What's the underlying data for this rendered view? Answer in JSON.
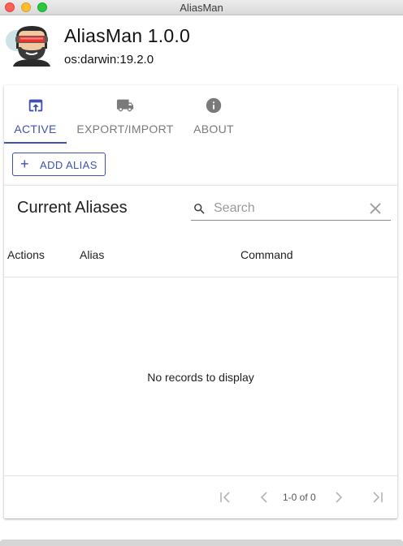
{
  "window": {
    "title": "AliasMan"
  },
  "header": {
    "title": "AliasMan 1.0.0",
    "subtitle": "os:darwin:19.2.0"
  },
  "tabs": [
    {
      "label": "ACTIVE",
      "icon": "open-in-browser-icon",
      "active": true
    },
    {
      "label": "EXPORT/IMPORT",
      "icon": "truck-icon",
      "active": false
    },
    {
      "label": "ABOUT",
      "icon": "info-icon",
      "active": false
    }
  ],
  "actions": {
    "add_label": "ADD ALIAS"
  },
  "table": {
    "title": "Current Aliases",
    "search_placeholder": "Search",
    "columns": [
      "Actions",
      "Alias",
      "Command"
    ],
    "empty_message": "No records to display",
    "pagination": "1-0 of 0"
  },
  "colors": {
    "accent": "#3f51b5",
    "icon_gray": "#7a7a7a"
  }
}
